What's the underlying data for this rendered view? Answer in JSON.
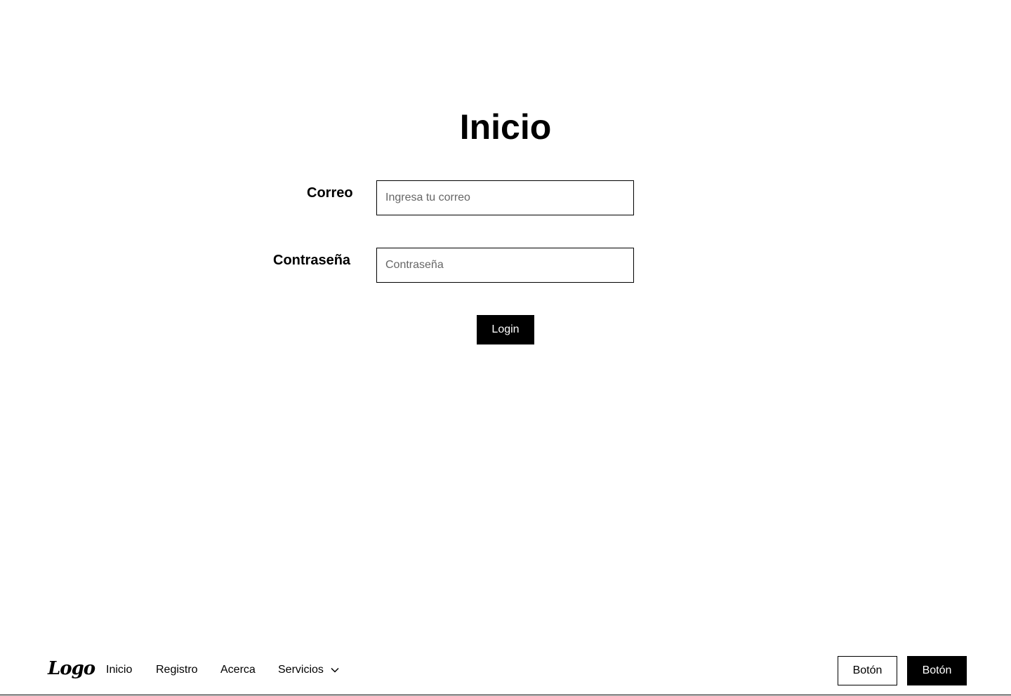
{
  "page": {
    "title": "Inicio"
  },
  "form": {
    "email_label": "Correo",
    "email_placeholder": "Ingresa tu correo",
    "email_value": "",
    "password_label": "Contraseña",
    "password_placeholder": "Contraseña",
    "password_value": "",
    "submit_label": "Login"
  },
  "footer": {
    "logo": "Logo",
    "nav": {
      "inicio": "Inicio",
      "registro": "Registro",
      "acerca": "Acerca",
      "servicios": "Servicios"
    },
    "services_icon": "chevron-down-icon",
    "secondary_button": "Botón",
    "primary_button": "Botón"
  },
  "colors": {
    "background": "#ffffff",
    "text": "#000000",
    "primary_button_bg": "#000000",
    "primary_button_text": "#ffffff",
    "placeholder": "#666666"
  }
}
